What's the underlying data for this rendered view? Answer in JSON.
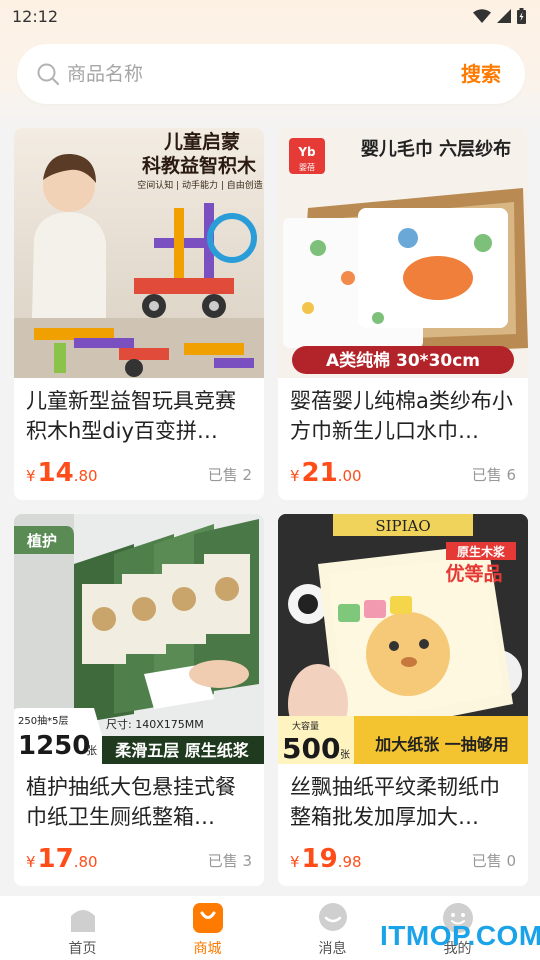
{
  "status": {
    "time": "12:12"
  },
  "search": {
    "placeholder": "商品名称",
    "button_label": "搜索"
  },
  "products": [
    {
      "title": "儿童新型益智玩具竞赛积木h型diy百变拼…",
      "currency": "¥",
      "price_int": "14",
      "price_dec": ".80",
      "sold": "已售 2",
      "image_text": {
        "line1": "儿童启蒙",
        "line2": "科教益智积木",
        "tags": "空间认知 | 动手能力 | 自由创造"
      }
    },
    {
      "title": "婴蓓婴儿纯棉a类纱布小方巾新生儿口水巾…",
      "currency": "¥",
      "price_int": "21",
      "price_dec": ".00",
      "sold": "已售 6",
      "image_text": {
        "brand": "婴蓓",
        "headline": "婴儿毛巾 六层纱布",
        "banner": "A类纯棉 30*30cm"
      }
    },
    {
      "title": "植护抽纸大包悬挂式餐巾纸卫生厕纸整箱…",
      "currency": "¥",
      "price_int": "17",
      "price_dec": ".80",
      "sold": "已售 3",
      "image_text": {
        "brand": "植护",
        "count_top": "250抽*5层",
        "count": "1250",
        "count_unit": "张",
        "size": "尺寸: 140X175MM",
        "banner": "柔滑五层 原生纸浆"
      }
    },
    {
      "title": "丝飘抽纸平纹柔韧纸巾整箱批发加厚加大…",
      "currency": "¥",
      "price_int": "19",
      "price_dec": ".98",
      "sold": "已售 0",
      "image_text": {
        "brand": "SIPIAO",
        "badge1": "原生木浆",
        "badge2": "优等品",
        "cap_label": "大容量",
        "count": "500",
        "count_unit": "张",
        "banner": "加大纸张 一抽够用"
      }
    }
  ],
  "tabs": [
    {
      "label": "首页",
      "icon": "home-icon"
    },
    {
      "label": "商城",
      "icon": "shop-bag-icon"
    },
    {
      "label": "消息",
      "icon": "message-icon"
    },
    {
      "label": "我的",
      "icon": "profile-icon"
    }
  ],
  "watermark": "ITMOP.COM",
  "colors": {
    "accent": "#ff7a00",
    "price": "#ff4d1a",
    "tab_inactive": "#cfcfcf"
  }
}
